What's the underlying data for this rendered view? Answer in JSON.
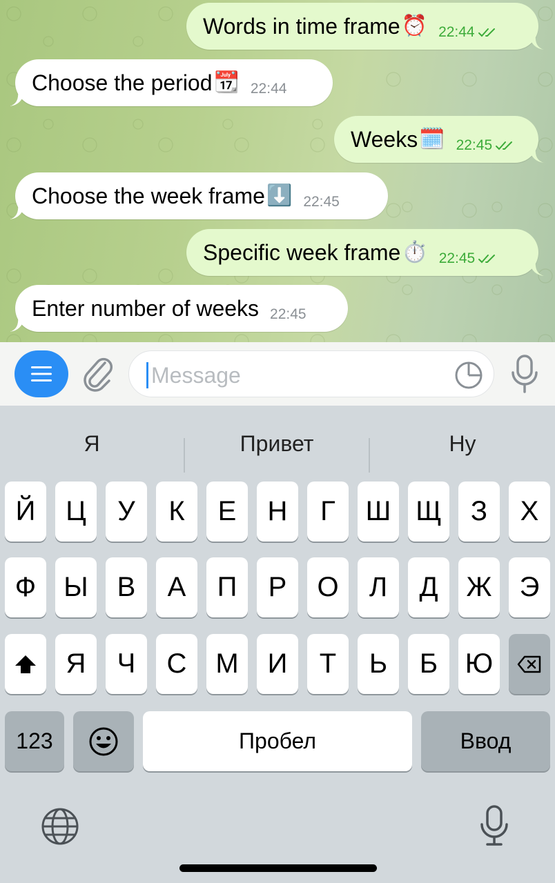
{
  "messages": [
    {
      "direction": "out",
      "text": "Words in time frame",
      "emoji": "⏰",
      "time": "22:44"
    },
    {
      "direction": "in",
      "text": "Choose the period",
      "emoji": "📆",
      "time": "22:44"
    },
    {
      "direction": "out",
      "text": "Weeks",
      "emoji": "🗓️",
      "time": "22:45"
    },
    {
      "direction": "in",
      "text": "Choose the week frame",
      "emoji": "⬇️",
      "time": "22:45"
    },
    {
      "direction": "out",
      "text": "Specific week frame",
      "emoji": "⏱️",
      "time": "22:45"
    },
    {
      "direction": "in",
      "text": "Enter number of weeks",
      "emoji": "",
      "time": "22:45"
    }
  ],
  "input": {
    "placeholder": "Message",
    "value": ""
  },
  "suggestions": [
    "Я",
    "Привет",
    "Ну"
  ],
  "keyboard": {
    "row1": [
      "Й",
      "Ц",
      "У",
      "К",
      "Е",
      "Н",
      "Г",
      "Ш",
      "Щ",
      "З",
      "Х"
    ],
    "row2": [
      "Ф",
      "Ы",
      "В",
      "А",
      "П",
      "Р",
      "О",
      "Л",
      "Д",
      "Ж",
      "Э"
    ],
    "row3": [
      "Я",
      "Ч",
      "С",
      "М",
      "И",
      "Т",
      "Ь",
      "Б",
      "Ю"
    ],
    "numbers_label": "123",
    "space_label": "Пробел",
    "return_label": "Ввод"
  },
  "colors": {
    "outgoing_bubble": "#e4f9cd",
    "incoming_bubble": "#ffffff",
    "outgoing_time": "#3cab39",
    "accent": "#2a8ef5"
  },
  "icons": [
    "menu-icon",
    "paperclip-icon",
    "sticker-icon",
    "microphone-icon",
    "shift-icon",
    "backspace-icon",
    "emoji-icon",
    "globe-icon",
    "dictation-icon"
  ]
}
